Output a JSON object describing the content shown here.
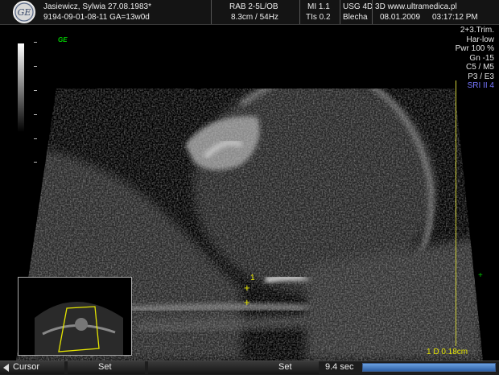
{
  "header": {
    "patient": "Jasiewicz, Sylwia 27.08.1983*",
    "exam_id": "9194-09-01-08-11  GA=13w0d",
    "probe": "RAB 2-5L/OB",
    "depth_freq": "8.3cm / 54Hz",
    "mi": "MI  1.1",
    "tis": "TIs  0.2",
    "clinic": "USG 4D 3D www.ultramedica.pl",
    "operator": "Blecha",
    "date": "08.01.2009",
    "time": "03:17:12 PM"
  },
  "side_params": [
    {
      "text": "2+3.Trim.",
      "highlight": false
    },
    {
      "text": "Har-low",
      "highlight": false
    },
    {
      "text": "Pwr 100 %",
      "highlight": false
    },
    {
      "text": "Gn -15",
      "highlight": false
    },
    {
      "text": "C5 / M5",
      "highlight": false
    },
    {
      "text": "P3 / E3",
      "highlight": false
    },
    {
      "text": "SRI II 4",
      "highlight": true
    }
  ],
  "ge_badge": "GE",
  "cursor_label": "1",
  "measurement": "1  D 0.18cm",
  "bottom_bar": {
    "cursor_label": "Cursor",
    "set1_label": "Set",
    "set2_label": "Set",
    "cine_time": "9.4 sec",
    "cine_progress": 1.0
  },
  "colors": {
    "accent_yellow": "#e6e600",
    "marker_green": "#00c000",
    "sri_blue": "#7777ff",
    "cine_bar": "#2d5fa5"
  }
}
